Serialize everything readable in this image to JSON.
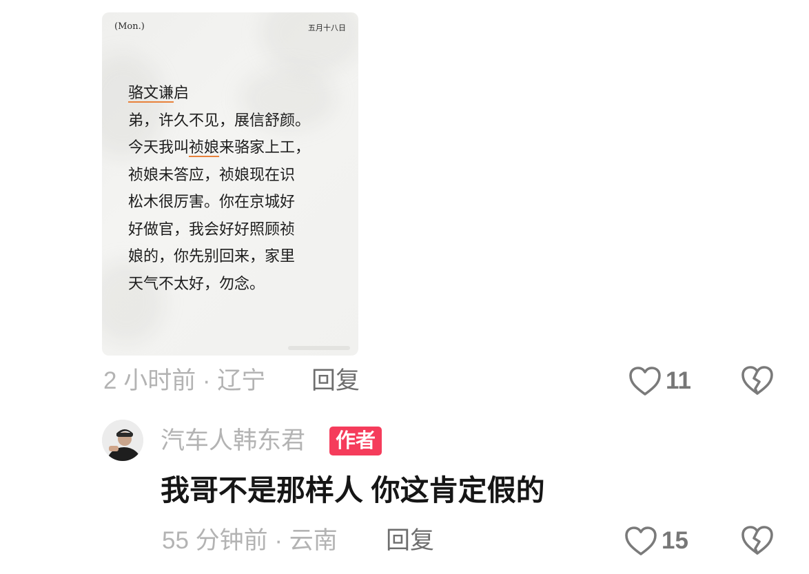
{
  "letter_image": {
    "day_label": "(Mon.)",
    "date_label": "五月十八日",
    "lines": [
      {
        "before": "",
        "underlined": "骆文谦",
        "after": "启"
      },
      {
        "before": "弟，许久不见，展信舒颜。",
        "underlined": "",
        "after": ""
      },
      {
        "before": "今天我叫",
        "underlined": "祯娘",
        "after": "来骆家上工，"
      },
      {
        "before": "祯娘未答应，祯娘现在识",
        "underlined": "",
        "after": ""
      },
      {
        "before": "松木很厉害。你在京城好",
        "underlined": "",
        "after": ""
      },
      {
        "before": "好做官，我会好好照顾祯",
        "underlined": "",
        "after": ""
      },
      {
        "before": "娘的，你先别回来，家里",
        "underlined": "",
        "after": ""
      },
      {
        "before": "天气不太好，勿念。",
        "underlined": "",
        "after": ""
      }
    ]
  },
  "comment1": {
    "meta": "2 小时前 · 辽宁",
    "reply_label": "回复",
    "like_count": "11"
  },
  "comment2": {
    "username": "汽车人韩东君",
    "badge": "作者",
    "text": "我哥不是那样人  你这肯定假的",
    "meta": "55 分钟前 · 云南",
    "reply_label": "回复",
    "like_count": "15"
  },
  "icons": {
    "like": "heart-outline-icon",
    "dislike": "broken-heart-icon"
  },
  "colors": {
    "meta_gray": "#b3b3b3",
    "reply_gray": "#6e6e6e",
    "author_badge": "#f53c5b",
    "underline_orange": "#e8813a"
  }
}
